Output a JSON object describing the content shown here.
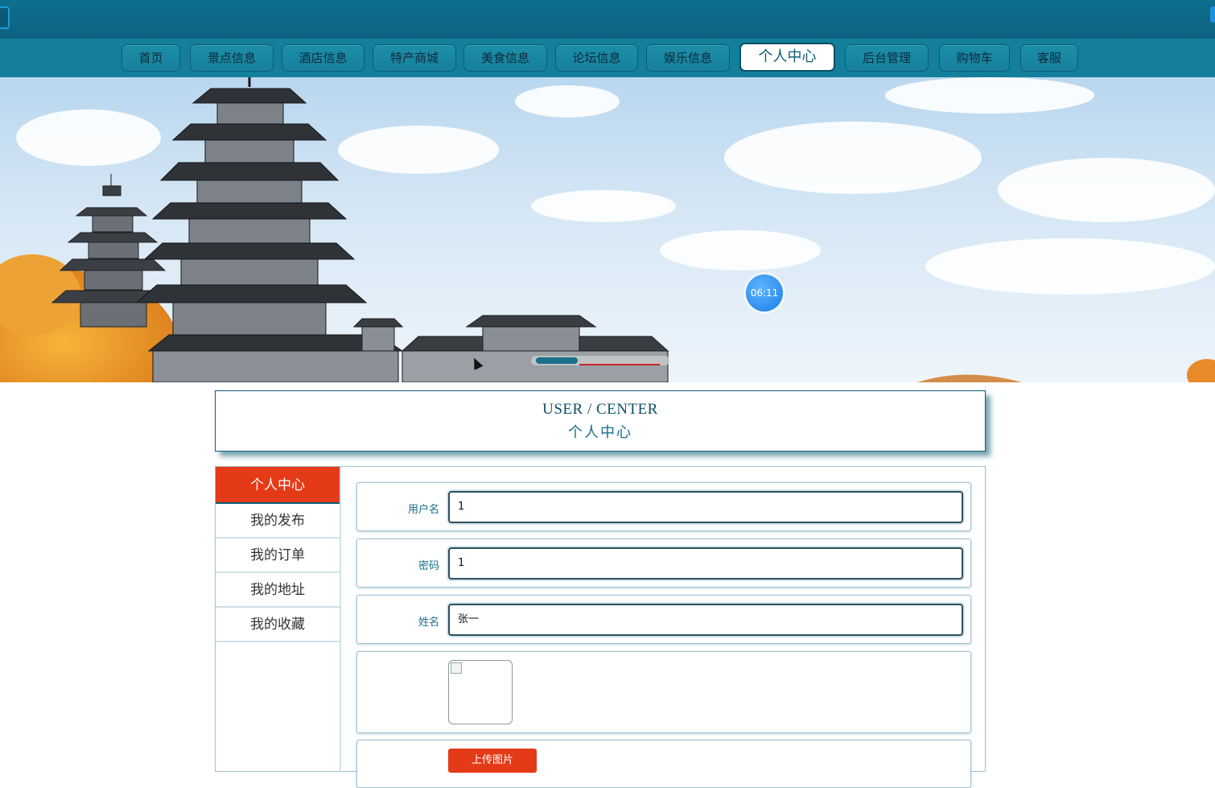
{
  "topbar": {},
  "nav": {
    "items": [
      {
        "label": "首页"
      },
      {
        "label": "景点信息"
      },
      {
        "label": "酒店信息"
      },
      {
        "label": "特产商城"
      },
      {
        "label": "美食信息"
      },
      {
        "label": "论坛信息"
      },
      {
        "label": "娱乐信息"
      },
      {
        "label": "个人中心"
      },
      {
        "label": "后台管理"
      },
      {
        "label": "购物车"
      },
      {
        "label": "客服"
      }
    ],
    "active_index": 7
  },
  "banner": {
    "timer": "06:11",
    "slide_index": 1,
    "slide_count": 3
  },
  "header": {
    "title_en": "USER / CENTER",
    "title_cn": "个人中心"
  },
  "side_menu": {
    "items": [
      {
        "label": "个人中心"
      },
      {
        "label": "我的发布"
      },
      {
        "label": "我的订单"
      },
      {
        "label": "我的地址"
      },
      {
        "label": "我的收藏"
      }
    ],
    "active_index": 0
  },
  "form": {
    "username": {
      "label": "用户名",
      "value": "1"
    },
    "password": {
      "label": "密码",
      "value": "1"
    },
    "name": {
      "label": "姓名",
      "value": "张一"
    },
    "avatar": {
      "label": ""
    },
    "upload_button": "上传图片"
  },
  "colors": {
    "topbar": "#0d6280",
    "navbar": "#137f9b",
    "accent_red": "#e53a17",
    "text_teal": "#1a6f8c"
  }
}
